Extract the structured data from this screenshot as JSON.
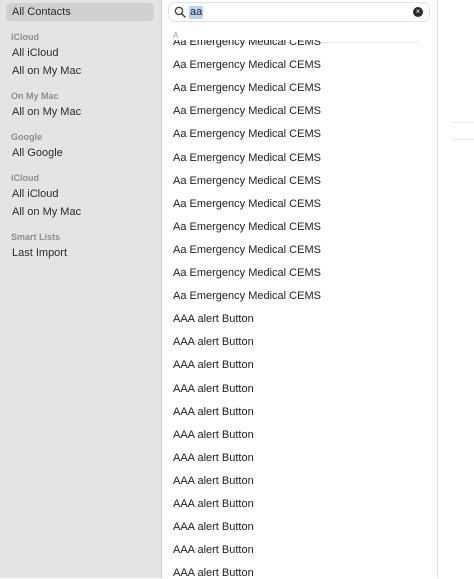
{
  "sidebar": {
    "selected": "All Contacts",
    "groups": [
      {
        "header": "",
        "items": [
          "All Contacts"
        ]
      },
      {
        "header": "iCloud",
        "items": [
          "All iCloud",
          "All on My Mac"
        ]
      },
      {
        "header": "On My Mac",
        "items": [
          "All on My Mac"
        ]
      },
      {
        "header": "Google",
        "items": [
          "All Google"
        ]
      },
      {
        "header": "iCloud",
        "items": [
          "All iCloud",
          "All on My Mac"
        ]
      },
      {
        "header": "Smart Lists",
        "items": [
          "Last Import"
        ]
      }
    ]
  },
  "search": {
    "value": "aa",
    "icon": "search-icon",
    "clear_icon": "clear-icon"
  },
  "contacts": {
    "section_letter": "A",
    "rows": [
      "Aa Emergency Medical CEMS",
      "Aa Emergency Medical CEMS",
      "Aa Emergency Medical CEMS",
      "Aa Emergency Medical CEMS",
      "Aa Emergency Medical CEMS",
      "Aa Emergency Medical CEMS",
      "Aa Emergency Medical CEMS",
      "Aa Emergency Medical CEMS",
      "Aa Emergency Medical CEMS",
      "Aa Emergency Medical CEMS",
      "Aa Emergency Medical CEMS",
      "Aa Emergency Medical CEMS",
      "AAA alert Button",
      "AAA alert Button",
      "AAA alert Button",
      "AAA alert Button",
      "AAA alert Button",
      "AAA alert Button",
      "AAA alert Button",
      "AAA alert Button",
      "AAA alert Button",
      "AAA alert Button",
      "AAA alert Button",
      "AAA alert Button"
    ]
  },
  "colors": {
    "sidebar_bg": "#e4e4e4",
    "selection_bg": "#d0d0d0",
    "search_highlight": "#b6d6fb"
  }
}
